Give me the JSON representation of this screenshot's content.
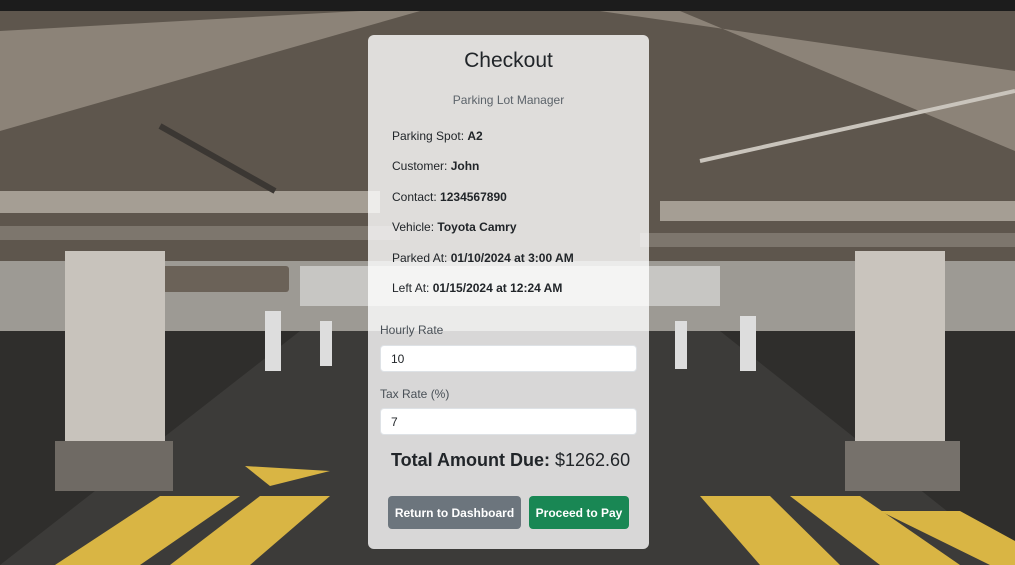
{
  "header": {
    "title": "Checkout",
    "subtitle": "Parking Lot Manager"
  },
  "details": [
    {
      "label": "Parking Spot:",
      "value": "A2"
    },
    {
      "label": "Customer:",
      "value": "John"
    },
    {
      "label": "Contact:",
      "value": "1234567890"
    },
    {
      "label": "Vehicle:",
      "value": "Toyota Camry"
    },
    {
      "label": "Parked At:",
      "value": "01/10/2024 at 3:00 AM"
    },
    {
      "label": "Left At:",
      "value": "01/15/2024 at 12:24 AM"
    }
  ],
  "form": {
    "hourly_rate_label": "Hourly Rate",
    "hourly_rate_value": "10",
    "tax_rate_label": "Tax Rate (%)",
    "tax_rate_value": "7"
  },
  "total": {
    "label": "Total Amount Due:",
    "value": "$1262.60"
  },
  "buttons": {
    "dashboard_label": "Return to Dashboard",
    "pay_label": "Proceed to Pay"
  },
  "colors": {
    "pay": "#198754",
    "secondary": "#6c757d",
    "topbar": "#1c1c1c"
  }
}
